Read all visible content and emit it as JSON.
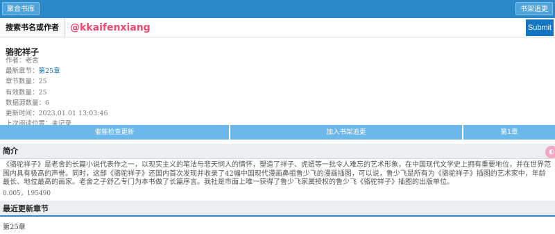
{
  "header": {
    "left_button": "聚合书库",
    "right_button": "书架追更"
  },
  "search": {
    "label": "搜索书名或作者",
    "value": "@kkaifenxiang",
    "submit": "Submit"
  },
  "book": {
    "title": "骆驼祥子",
    "author_label": "作者：",
    "author": "老舍",
    "latest_label": "最新章节：",
    "latest_chapter": "第25章",
    "chapters_label": "章节数量：",
    "chapters": "25",
    "valid_label": "有效数量：",
    "valid": "25",
    "sources_label": "数据源数量：",
    "sources": "6",
    "updated_label": "更新时间：",
    "updated": "2023.01.01 13:03:46",
    "last_read_label": "上次阅读位置：",
    "last_read": "未记录"
  },
  "actions": {
    "update": "催催检查更新",
    "shelf": "加入书架追更",
    "first": "第1章"
  },
  "intro": {
    "heading": "简介",
    "text": "《骆驼祥子》是老舍的长篇小说代表作之一，以现实主义的笔法与悲天悯人的情怀，塑造了祥子、虎妞等一批令人难忘的艺术形象，在中国现代文学史上拥有重要地位，并在世界范围内具有极高的声誉。同时，这部《骆驼祥子》还国内首次发现并收录了42幅中国现代漫画鼻祖鲁少飞的漫画插图，可以说，鲁少飞是所有为《骆驼祥子》插图的艺术家中，年龄最长、地位最高的画家。老舍之子舒乙专门为本书做了长篇序言。我社是市面上唯一获得了鲁少飞家属授权的鲁少飞《骆驼祥子》插图的出版单位。",
    "stats": "0.005，195490"
  },
  "latest": {
    "heading": "最近更新章节",
    "items": [
      "第25章"
    ]
  },
  "colors": {
    "brand": "#2a88c8",
    "accent": "#6cb8ea",
    "handle": "#f04870"
  },
  "icons": {
    "float": "bookmark-icon"
  }
}
